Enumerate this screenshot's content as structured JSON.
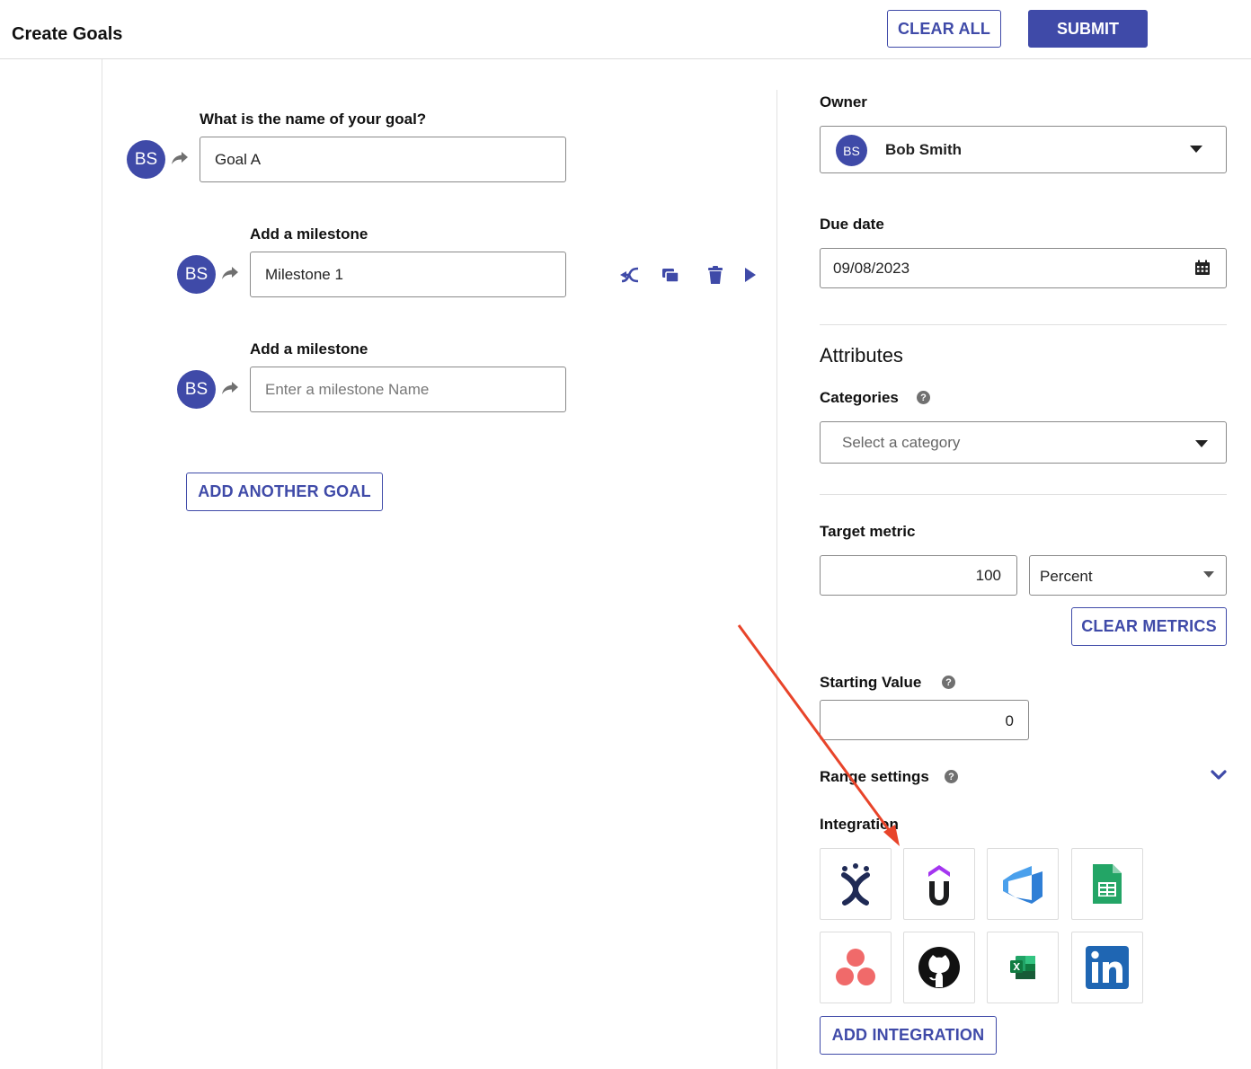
{
  "header": {
    "title": "Create Goals",
    "clear_all_label": "CLEAR ALL",
    "submit_label": "SUBMIT"
  },
  "goal": {
    "question": "What is the name of your goal?",
    "avatar_initials": "BS",
    "value": "Goal A"
  },
  "milestones": [
    {
      "label": "Add a milestone",
      "avatar_initials": "BS",
      "value": "Milestone 1",
      "placeholder": ""
    },
    {
      "label": "Add a milestone",
      "avatar_initials": "BS",
      "value": "",
      "placeholder": "Enter a milestone Name"
    }
  ],
  "add_goal_label": "ADD ANOTHER GOAL",
  "owner": {
    "label": "Owner",
    "avatar_initials": "BS",
    "name": "Bob Smith"
  },
  "due_date": {
    "label": "Due date",
    "value": "09/08/2023"
  },
  "attributes": {
    "heading": "Attributes",
    "categories_label": "Categories",
    "categories_placeholder": "Select a category"
  },
  "target_metric": {
    "label": "Target metric",
    "value": "100",
    "unit": "Percent",
    "clear_label": "CLEAR METRICS"
  },
  "starting_value": {
    "label": "Starting Value",
    "value": "0"
  },
  "range_settings": {
    "label": "Range settings"
  },
  "integration": {
    "label": "Integration",
    "items": [
      "jira-icon",
      "udemy-icon",
      "azure-devops-icon",
      "google-sheets-icon",
      "asana-icon",
      "github-icon",
      "excel-icon",
      "linkedin-icon"
    ],
    "add_label": "ADD INTEGRATION"
  },
  "colors": {
    "accent": "#3f4aa8",
    "annotation_arrow": "#e8442a"
  }
}
